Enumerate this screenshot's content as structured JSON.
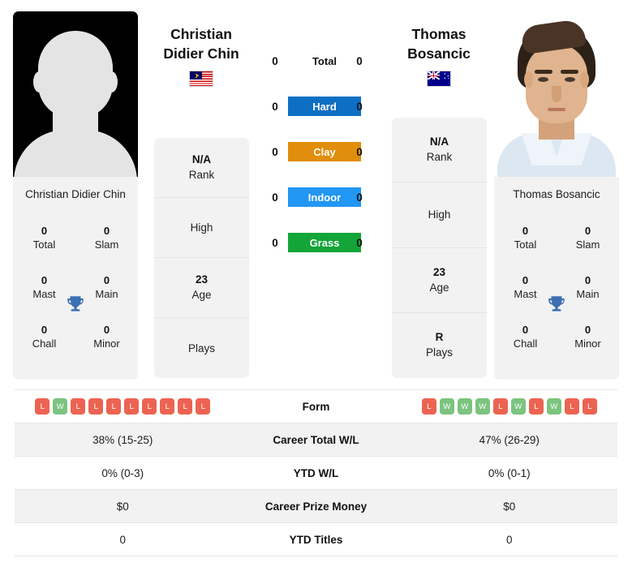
{
  "players": {
    "left": {
      "first_name": "Christian",
      "last_name": "Didier Chin",
      "photo_caption": "Christian Didier Chin",
      "country": "Malaysia",
      "flag_icon": "malaysia-flag-icon",
      "photo_type": "placeholder-silhouette",
      "info": [
        {
          "value": "N/A",
          "label": "Rank"
        },
        {
          "value": "",
          "label": "High"
        },
        {
          "value": "23",
          "label": "Age"
        },
        {
          "value": "",
          "label": "Plays"
        }
      ],
      "titles": [
        {
          "value": "0",
          "label": "Total"
        },
        {
          "value": "0",
          "label": "Slam"
        },
        {
          "value": "0",
          "label": "Mast"
        },
        {
          "value": "0",
          "label": "Main"
        },
        {
          "value": "0",
          "label": "Chall"
        },
        {
          "value": "0",
          "label": "Minor"
        }
      ],
      "surface_wins": {
        "total": "0",
        "hard": "0",
        "clay": "0",
        "indoor": "0",
        "grass": "0"
      },
      "form": [
        "L",
        "W",
        "L",
        "L",
        "L",
        "L",
        "L",
        "L",
        "L",
        "L"
      ],
      "career_total_wl": "38% (15-25)",
      "ytd_wl": "0% (0-3)",
      "career_prize_money": "$0",
      "ytd_titles": "0"
    },
    "right": {
      "first_name": "Thomas",
      "last_name": "Bosancic",
      "photo_caption": "Thomas Bosancic",
      "country": "Australia",
      "flag_icon": "australia-flag-icon",
      "photo_type": "player-photo",
      "info": [
        {
          "value": "N/A",
          "label": "Rank"
        },
        {
          "value": "",
          "label": "High"
        },
        {
          "value": "23",
          "label": "Age"
        },
        {
          "value": "R",
          "label": "Plays"
        }
      ],
      "titles": [
        {
          "value": "0",
          "label": "Total"
        },
        {
          "value": "0",
          "label": "Slam"
        },
        {
          "value": "0",
          "label": "Mast"
        },
        {
          "value": "0",
          "label": "Main"
        },
        {
          "value": "0",
          "label": "Chall"
        },
        {
          "value": "0",
          "label": "Minor"
        }
      ],
      "surface_wins": {
        "total": "0",
        "hard": "0",
        "clay": "0",
        "indoor": "0",
        "grass": "0"
      },
      "form": [
        "L",
        "W",
        "W",
        "W",
        "L",
        "W",
        "L",
        "W",
        "L",
        "L"
      ],
      "career_total_wl": "47% (26-29)",
      "ytd_wl": "0% (0-1)",
      "career_prize_money": "$0",
      "ytd_titles": "0"
    }
  },
  "surfaces": [
    {
      "key": "total",
      "label": "Total",
      "color": "transparent",
      "has_bar": false
    },
    {
      "key": "hard",
      "label": "Hard",
      "color": "#0d6fc4",
      "has_bar": true
    },
    {
      "key": "clay",
      "label": "Clay",
      "color": "#e08e0b",
      "has_bar": true
    },
    {
      "key": "indoor",
      "label": "Indoor",
      "color": "#2196f3",
      "has_bar": true
    },
    {
      "key": "grass",
      "label": "Grass",
      "color": "#13a538",
      "has_bar": true
    }
  ],
  "table_rows": [
    {
      "label": "Form",
      "type": "form",
      "shaded": false
    },
    {
      "label": "Career Total W/L",
      "type": "text",
      "shaded": true,
      "field": "career_total_wl"
    },
    {
      "label": "YTD W/L",
      "type": "text",
      "shaded": false,
      "field": "ytd_wl"
    },
    {
      "label": "Career Prize Money",
      "type": "text",
      "shaded": true,
      "field": "career_prize_money"
    },
    {
      "label": "YTD Titles",
      "type": "text",
      "shaded": false,
      "field": "ytd_titles"
    }
  ],
  "colors": {
    "win_badge": "#7cc47f",
    "loss_badge": "#ec6352",
    "trophy": "#3d6fb4",
    "card_bg": "#f2f2f2",
    "row_shade": "#f2f2f2"
  },
  "icons": {
    "trophy": "trophy-icon"
  }
}
